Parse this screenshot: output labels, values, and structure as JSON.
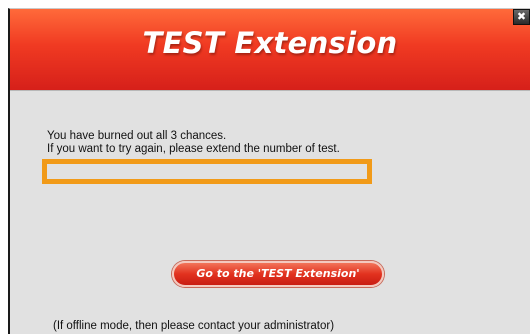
{
  "dialog": {
    "title": "TEST Extension",
    "close_glyph": "✖",
    "message_lines": [
      "You have burned out all 3 chances.",
      "If you want to try again, please extend the number of test."
    ],
    "highlight_line": "(If offline mode, then please contact your administrator)",
    "goto_button_label": "Go to the 'TEST Extension'"
  },
  "colors": {
    "header_red": "#e5301f",
    "highlight_orange": "#f19a18",
    "body_gray": "#e1e1e1"
  }
}
